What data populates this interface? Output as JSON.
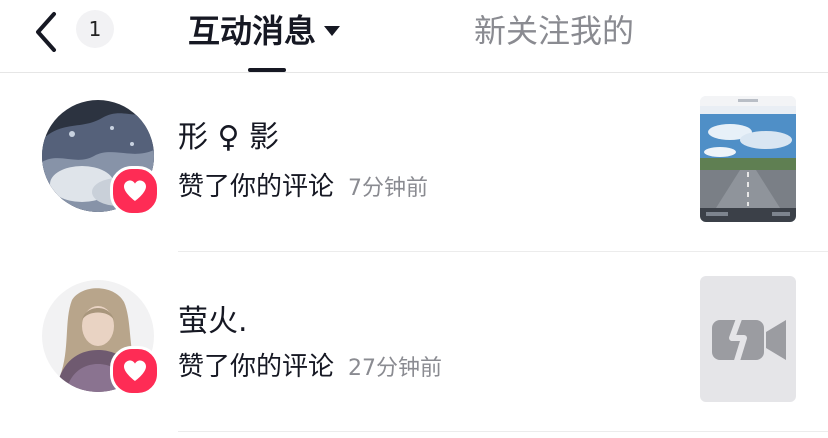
{
  "header": {
    "back_icon": "chevron-left-icon",
    "badge_count": "1",
    "active_tab": "互动消息",
    "inactive_tab": "新关注我的"
  },
  "notifications": [
    {
      "user_name": "形 ♀ 影",
      "action": "赞了你的评论",
      "time": "7分钟前",
      "badge_icon": "heart-icon",
      "thumbnail": "road-photo"
    },
    {
      "user_name": "萤火.",
      "action": "赞了你的评论",
      "time": "27分钟前",
      "badge_icon": "heart-icon",
      "thumbnail": "video-off-icon"
    }
  ],
  "colors": {
    "accent": "#fe2c55",
    "text": "#161823",
    "muted": "#8a8b91"
  }
}
